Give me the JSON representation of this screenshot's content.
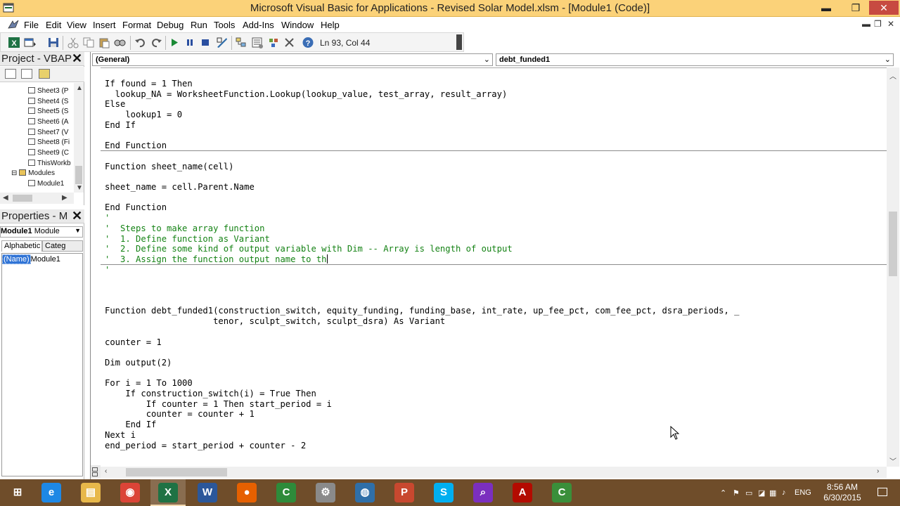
{
  "window": {
    "title": "Microsoft Visual Basic for Applications - Revised Solar Model.xlsm - [Module1 (Code)]",
    "minimize": "▬",
    "restore": "❐",
    "close": "✕"
  },
  "menubar": {
    "items": [
      "File",
      "Edit",
      "View",
      "Insert",
      "Format",
      "Debug",
      "Run",
      "Tools",
      "Add-Ins",
      "Window",
      "Help"
    ],
    "mdi_min": "▬",
    "mdi_restore": "❐",
    "mdi_close": "✕"
  },
  "toolbar": {
    "icons": [
      "excel-view-icon",
      "insert-module-icon",
      "save-icon",
      "cut-icon",
      "copy-icon",
      "paste-icon",
      "find-icon",
      "undo-icon",
      "redo-icon",
      "run-icon",
      "break-icon",
      "reset-icon",
      "design-mode-icon",
      "project-explorer-icon",
      "properties-icon",
      "object-browser-icon",
      "toolbox-icon",
      "help-icon"
    ],
    "position": "Ln 93, Col 44"
  },
  "project_panel": {
    "title": "Project - VBAP",
    "close": "✕",
    "tree": [
      {
        "label": "Sheet3 (P"
      },
      {
        "label": "Sheet4 (S"
      },
      {
        "label": "Sheet5 (S"
      },
      {
        "label": "Sheet6 (A"
      },
      {
        "label": "Sheet7 (V"
      },
      {
        "label": "Sheet8 (Fi"
      },
      {
        "label": "Sheet9 (C"
      },
      {
        "label": "ThisWorkb"
      },
      {
        "label": "Modules"
      },
      {
        "label": "Module1"
      }
    ],
    "collapse_glyph": "⊟"
  },
  "properties_panel": {
    "title": "Properties - M",
    "close": "✕",
    "object_name": "Module1",
    "object_type": "Module",
    "tabs": [
      "Alphabetic",
      "Categ"
    ],
    "property_key": "(Name)",
    "property_value": "Module1"
  },
  "code_window": {
    "object_combo": "(General)",
    "procedure_combo": "debt_funded1",
    "lines": [
      {
        "text": "If found = 1 Then",
        "style": "code"
      },
      {
        "text": "  lookup_NA = WorksheetFunction.Lookup(lookup_value, test_array, result_array)",
        "style": "code"
      },
      {
        "text": "Else",
        "style": "code"
      },
      {
        "text": "    lookup1 = 0",
        "style": "code"
      },
      {
        "text": "End If",
        "style": "code"
      },
      {
        "text": "",
        "style": "code"
      },
      {
        "text": "End Function",
        "style": "code"
      },
      {
        "text": "",
        "style": "code"
      },
      {
        "text": "Function sheet_name(cell)",
        "style": "code"
      },
      {
        "text": "",
        "style": "code"
      },
      {
        "text": "sheet_name = cell.Parent.Name",
        "style": "code"
      },
      {
        "text": "",
        "style": "code"
      },
      {
        "text": "End Function",
        "style": "code"
      },
      {
        "text": "'",
        "style": "comment"
      },
      {
        "text": "'  Steps to make array function",
        "style": "comment"
      },
      {
        "text": "'  1. Define function as Variant",
        "style": "comment"
      },
      {
        "text": "'  2. Define some kind of output variable with Dim -- Array is length of output",
        "style": "comment"
      },
      {
        "text": "'  3. Assign the function output name to th",
        "style": "comment"
      },
      {
        "text": "'",
        "style": "comment"
      },
      {
        "text": "",
        "style": "code"
      },
      {
        "text": "",
        "style": "code"
      },
      {
        "text": "",
        "style": "code"
      },
      {
        "text": "Function debt_funded1(construction_switch, equity_funding, funding_base, int_rate, up_fee_pct, com_fee_pct, dsra_periods, _",
        "style": "code"
      },
      {
        "text": "                     tenor, sculpt_switch, sculpt_dsra) As Variant",
        "style": "code"
      },
      {
        "text": "",
        "style": "code"
      },
      {
        "text": "counter = 1",
        "style": "code"
      },
      {
        "text": "",
        "style": "code"
      },
      {
        "text": "Dim output(2)",
        "style": "code"
      },
      {
        "text": "",
        "style": "code"
      },
      {
        "text": "For i = 1 To 1000",
        "style": "code"
      },
      {
        "text": "    If construction_switch(i) = True Then",
        "style": "code"
      },
      {
        "text": "        If counter = 1 Then start_period = i",
        "style": "code"
      },
      {
        "text": "        counter = counter + 1",
        "style": "code"
      },
      {
        "text": "    End If",
        "style": "code"
      },
      {
        "text": "Next i",
        "style": "code"
      },
      {
        "text": "end_period = start_period + counter - 2",
        "style": "code"
      }
    ]
  },
  "taskbar": {
    "apps": [
      {
        "name": "start-button",
        "glyph": "⊞",
        "color": "#6f4d2a"
      },
      {
        "name": "internet-explorer-icon",
        "glyph": "e",
        "color": "#1e88e5"
      },
      {
        "name": "file-explorer-icon",
        "glyph": "▤",
        "color": "#e8b84a"
      },
      {
        "name": "chrome-icon",
        "glyph": "◉",
        "color": "#db4437"
      },
      {
        "name": "excel-icon",
        "glyph": "X",
        "color": "#1f7244"
      },
      {
        "name": "word-icon",
        "glyph": "W",
        "color": "#2b579a"
      },
      {
        "name": "firefox-icon",
        "glyph": "●",
        "color": "#e66000"
      },
      {
        "name": "camtasia-icon",
        "glyph": "C",
        "color": "#2e8b3a"
      },
      {
        "name": "tools-icon",
        "glyph": "⚙",
        "color": "#8a8a8a"
      },
      {
        "name": "globe-icon",
        "glyph": "◍",
        "color": "#2f6fa8"
      },
      {
        "name": "powerpoint-icon",
        "glyph": "P",
        "color": "#c8482f"
      },
      {
        "name": "skype-icon",
        "glyph": "S",
        "color": "#00aff0"
      },
      {
        "name": "search-app-icon",
        "glyph": "⌕",
        "color": "#7b2fbf"
      },
      {
        "name": "acrobat-icon",
        "glyph": "A",
        "color": "#b30b00"
      },
      {
        "name": "camtasia-recorder-icon",
        "glyph": "C",
        "color": "#3a8f3a"
      }
    ],
    "active_apps": [
      4
    ],
    "tray_icons": [
      "⌃",
      "⚑",
      "▭",
      "◪",
      "▦",
      "♪"
    ],
    "language": "ENG",
    "time": "8:56 AM",
    "date": "6/30/2015"
  }
}
